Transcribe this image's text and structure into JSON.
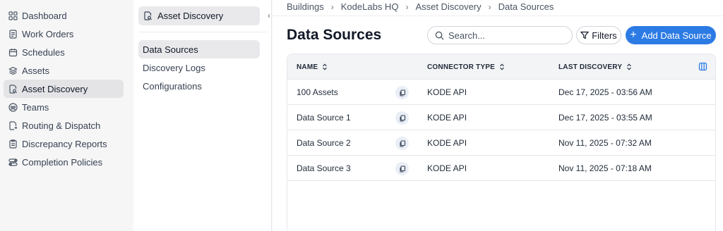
{
  "nav": {
    "items": [
      {
        "label": "Dashboard",
        "icon": "grid-icon"
      },
      {
        "label": "Work Orders",
        "icon": "clipboard-icon"
      },
      {
        "label": "Schedules",
        "icon": "calendar-icon"
      },
      {
        "label": "Assets",
        "icon": "layers-icon"
      },
      {
        "label": "Asset Discovery",
        "icon": "file-search-icon",
        "active": true
      },
      {
        "label": "Teams",
        "icon": "team-icon"
      },
      {
        "label": "Routing & Dispatch",
        "icon": "route-icon"
      },
      {
        "label": "Discrepancy Reports",
        "icon": "report-icon"
      },
      {
        "label": "Completion Policies",
        "icon": "toggles-icon"
      }
    ]
  },
  "subnav": {
    "title": "Asset Discovery",
    "items": [
      {
        "label": "Data Sources",
        "active": true
      },
      {
        "label": "Discovery Logs"
      },
      {
        "label": "Configurations"
      }
    ]
  },
  "breadcrumb": [
    "Buildings",
    "KodeLabs HQ",
    "Asset Discovery",
    "Data Sources"
  ],
  "page": {
    "title": "Data Sources",
    "search_placeholder": "Search...",
    "filters_label": "Filters",
    "add_label": "Add Data Source",
    "accent": "#2c7be5"
  },
  "table": {
    "columns": [
      "NAME",
      "CONNECTOR TYPE",
      "LAST DISCOVERY"
    ],
    "rows": [
      {
        "name": "100 Assets",
        "connector": "KODE API",
        "last": "Dec 17, 2025 - 03:56 AM"
      },
      {
        "name": "Data Source 1",
        "connector": "KODE API",
        "last": "Dec 17, 2025 - 03:55 AM"
      },
      {
        "name": "Data Source 2",
        "connector": "KODE API",
        "last": "Nov 11, 2025 - 07:32 AM"
      },
      {
        "name": "Data Source 3",
        "connector": "KODE API",
        "last": "Nov 11, 2025 - 07:18 AM"
      }
    ]
  }
}
